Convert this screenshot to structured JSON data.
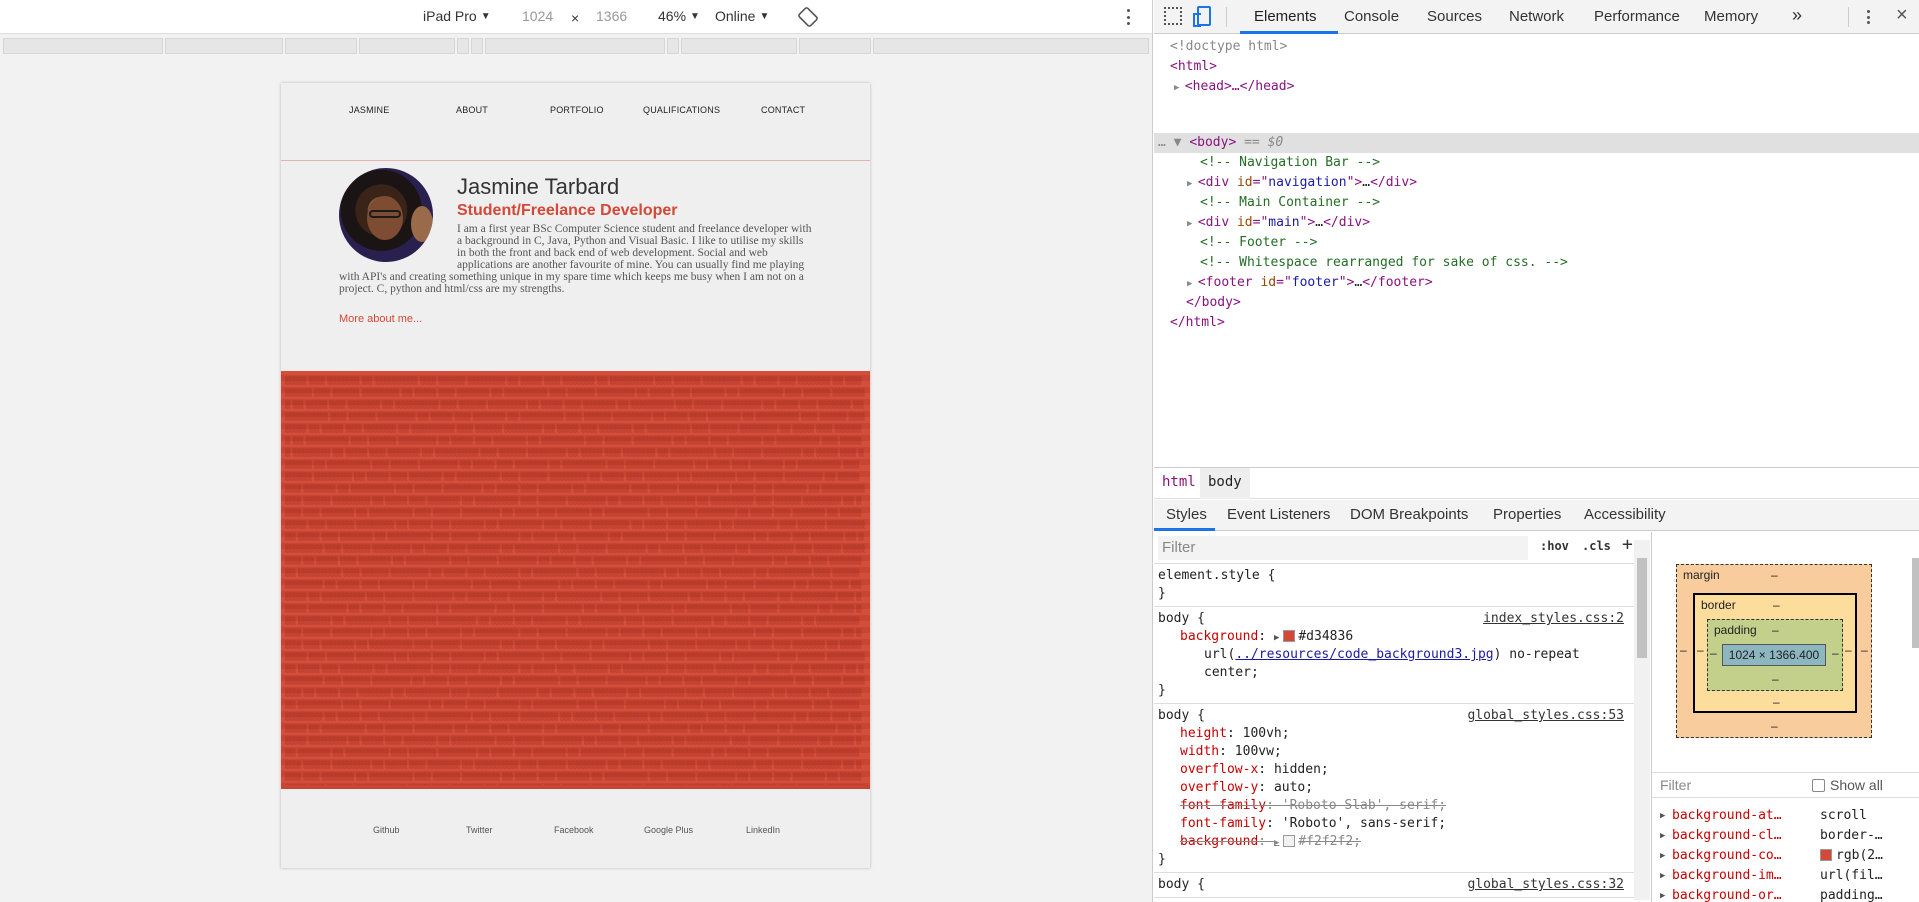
{
  "device_toolbar": {
    "device": "iPad Pro",
    "width": "1024",
    "times": "×",
    "height": "1366",
    "zoom": "46%",
    "network": "Online"
  },
  "site": {
    "nav": [
      "JASMINE",
      "ABOUT",
      "PORTFOLIO",
      "QUALIFICATIONS",
      "CONTACT"
    ],
    "name": "Jasmine Tarbard",
    "role": "Student/Freelance Developer",
    "bio": "I am a first year BSc Computer Science student and freelance developer with a background in C, Java, Python and Visual Basic. I like to utilise my skills in both the front and back end of web development. Social and web applications are another favourite of mine. You can usually find me playing with API's and creating something unique in my spare time which keeps me busy when I am not on a project. C, python and html/css are my strengths.",
    "more_link": "More about me...",
    "footer": [
      "Github",
      "Twitter",
      "Facebook",
      "Google Plus",
      "LinkedIn"
    ],
    "accent": "#d34836"
  },
  "devtools": {
    "tabs": [
      "Elements",
      "Console",
      "Sources",
      "Network",
      "Performance",
      "Memory",
      "»"
    ],
    "active_tab": "Elements",
    "dom": {
      "doctype": "<!doctype html>",
      "html_open": "<html>",
      "head": "<head>…</head>",
      "body_open": "<body>",
      "body_marker": "== $0",
      "c_nav": "<!-- Navigation Bar -->",
      "div_nav_id": "navigation",
      "c_main": "<!-- Main Container -->",
      "div_main_id": "main",
      "c_footer": "<!-- Footer -->",
      "c_ws": "<!-- Whitespace rearranged for sake of css. -->",
      "footer_id": "footer",
      "body_close": "</body>",
      "html_close": "</html>"
    },
    "breadcrumbs": [
      "html",
      "body"
    ],
    "sub_tabs": [
      "Styles",
      "Event Listeners",
      "DOM Breakpoints",
      "Properties",
      "Accessibility"
    ],
    "filter_placeholder": "Filter",
    "hov": ":hov",
    "cls": ".cls",
    "plus": "+",
    "rules": {
      "element_style": "element.style {",
      "rule1_selector": "body {",
      "rule1_source": "index_styles.css:2",
      "rule1_bg_prop": "background",
      "rule1_bg_color": "#d34836",
      "rule1_url": "../resources/code_background3.jpg",
      "rule1_tail": "no-repeat",
      "rule1_center": "center;",
      "rule2_selector": "body {",
      "rule2_source": "global_styles.css:53",
      "rule2_props": [
        {
          "prop": "height",
          "val": "100vh;"
        },
        {
          "prop": "width",
          "val": "100vw;"
        },
        {
          "prop": "overflow-x",
          "val": "hidden;"
        },
        {
          "prop": "overflow-y",
          "val": "auto;"
        },
        {
          "prop": "font-family",
          "val": "'Roboto Slab', serif;"
        },
        {
          "prop": "font-family",
          "val": "'Roboto', sans-serif;"
        },
        {
          "prop": "background",
          "val": "#f2f2f2;"
        }
      ],
      "rule3_selector": "body {",
      "rule3_source": "global_styles.css:32"
    },
    "box_model": {
      "margin": "margin",
      "border": "border",
      "padding": "padding",
      "dash": "–",
      "content": "1024 × 1366.400"
    },
    "computed_filter": "Filter",
    "show_all": "Show all",
    "computed": [
      {
        "prop": "background-at…",
        "val": "scroll"
      },
      {
        "prop": "background-cl…",
        "val": "border-…"
      },
      {
        "prop": "background-co…",
        "val": "rgb(2…"
      },
      {
        "prop": "background-im…",
        "val": "url(fil…"
      },
      {
        "prop": "background-or…",
        "val": "padding…"
      }
    ]
  }
}
